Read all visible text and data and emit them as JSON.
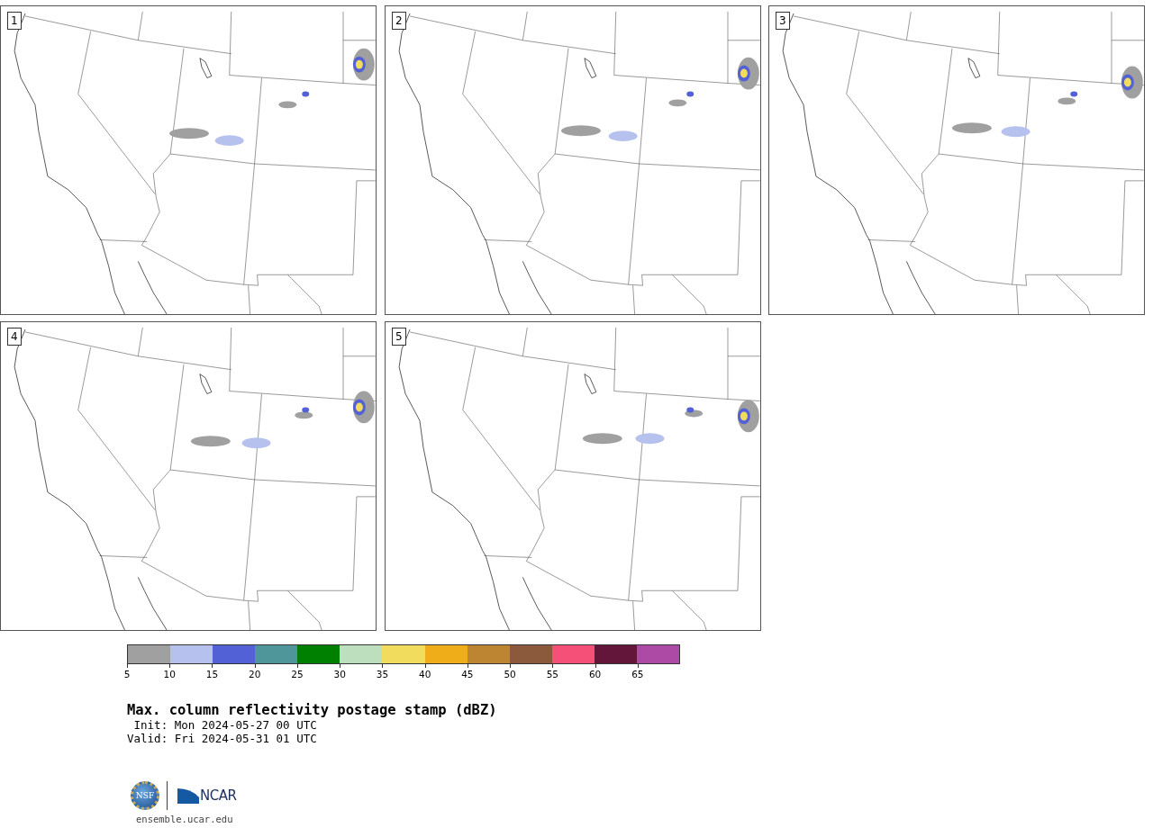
{
  "panels": [
    {
      "label": "1"
    },
    {
      "label": "2"
    },
    {
      "label": "3"
    },
    {
      "label": "4"
    },
    {
      "label": "5"
    }
  ],
  "colorbar": {
    "segments": [
      {
        "color": "#a0a0a0"
      },
      {
        "color": "#b7c1ee"
      },
      {
        "color": "#5261d5"
      },
      {
        "color": "#4f969b"
      },
      {
        "color": "#008000"
      },
      {
        "color": "#bedfbe"
      },
      {
        "color": "#f2dc5d"
      },
      {
        "color": "#f0ad1a"
      },
      {
        "color": "#bd8432"
      },
      {
        "color": "#8b5a3c"
      },
      {
        "color": "#f45078"
      },
      {
        "color": "#63163a"
      },
      {
        "color": "#ac4aa6"
      }
    ],
    "ticks": [
      "5",
      "10",
      "15",
      "20",
      "25",
      "30",
      "35",
      "40",
      "45",
      "50",
      "55",
      "60",
      "65"
    ]
  },
  "title": "Max. column reflectivity postage stamp (dBZ)",
  "init": " Init: Mon 2024-05-27 00 UTC",
  "valid": "Valid: Fri 2024-05-31 01 UTC",
  "logo": {
    "seal": "NSF",
    "wordmark": "NCAR"
  },
  "footer": "ensemble.ucar.edu"
}
